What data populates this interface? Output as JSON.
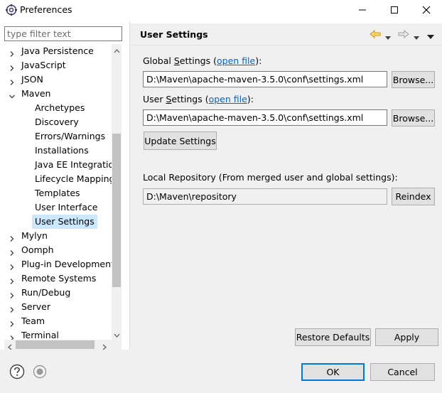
{
  "window": {
    "title": "Preferences"
  },
  "filter": {
    "placeholder": "type filter text"
  },
  "tree": {
    "items": [
      {
        "label": "Java Persistence",
        "level": 0,
        "expanded": false
      },
      {
        "label": "JavaScript",
        "level": 0,
        "expanded": false
      },
      {
        "label": "JSON",
        "level": 0,
        "expanded": false
      },
      {
        "label": "Maven",
        "level": 0,
        "expanded": true
      },
      {
        "label": "Archetypes",
        "level": 1
      },
      {
        "label": "Discovery",
        "level": 1
      },
      {
        "label": "Errors/Warnings",
        "level": 1
      },
      {
        "label": "Installations",
        "level": 1
      },
      {
        "label": "Java EE Integration",
        "level": 1
      },
      {
        "label": "Lifecycle Mapping",
        "level": 1
      },
      {
        "label": "Templates",
        "level": 1
      },
      {
        "label": "User Interface",
        "level": 1
      },
      {
        "label": "User Settings",
        "level": 1,
        "selected": true
      },
      {
        "label": "Mylyn",
        "level": 0,
        "expanded": false
      },
      {
        "label": "Oomph",
        "level": 0,
        "expanded": false
      },
      {
        "label": "Plug-in Development",
        "level": 0,
        "expanded": false
      },
      {
        "label": "Remote Systems",
        "level": 0,
        "expanded": false
      },
      {
        "label": "Run/Debug",
        "level": 0,
        "expanded": false
      },
      {
        "label": "Server",
        "level": 0,
        "expanded": false
      },
      {
        "label": "Team",
        "level": 0,
        "expanded": false
      },
      {
        "label": "Terminal",
        "level": 0,
        "expanded": false
      }
    ]
  },
  "page": {
    "title": "User Settings",
    "global_settings": {
      "label_pre": "Global ",
      "label_mnemonic": "S",
      "label_post": "ettings (",
      "link": "open file",
      "label_end": "):",
      "value": "D:\\Maven\\apache-maven-3.5.0\\conf\\settings.xml",
      "browse_label": "Browse..."
    },
    "user_settings": {
      "label_pre": "User ",
      "label_mnemonic": "S",
      "label_post": "ettings (",
      "link": "open file",
      "label_end": "):",
      "value": "D:\\Maven\\apache-maven-3.5.0\\conf\\settings.xml",
      "browse_label": "Browse..."
    },
    "update_label": "Update Settings",
    "local_repo": {
      "label": "Local Repository (From merged user and global settings):",
      "value": "D:\\Maven\\repository",
      "reindex_label": "Reindex"
    },
    "restore_defaults_label": "Restore Defaults",
    "apply_label": "Apply"
  },
  "footer": {
    "ok_label": "OK",
    "cancel_label": "Cancel"
  },
  "colors": {
    "accent": "#0078d7",
    "link": "#0066cc",
    "selection": "#cce8ff",
    "arrow": "#e8a317"
  }
}
